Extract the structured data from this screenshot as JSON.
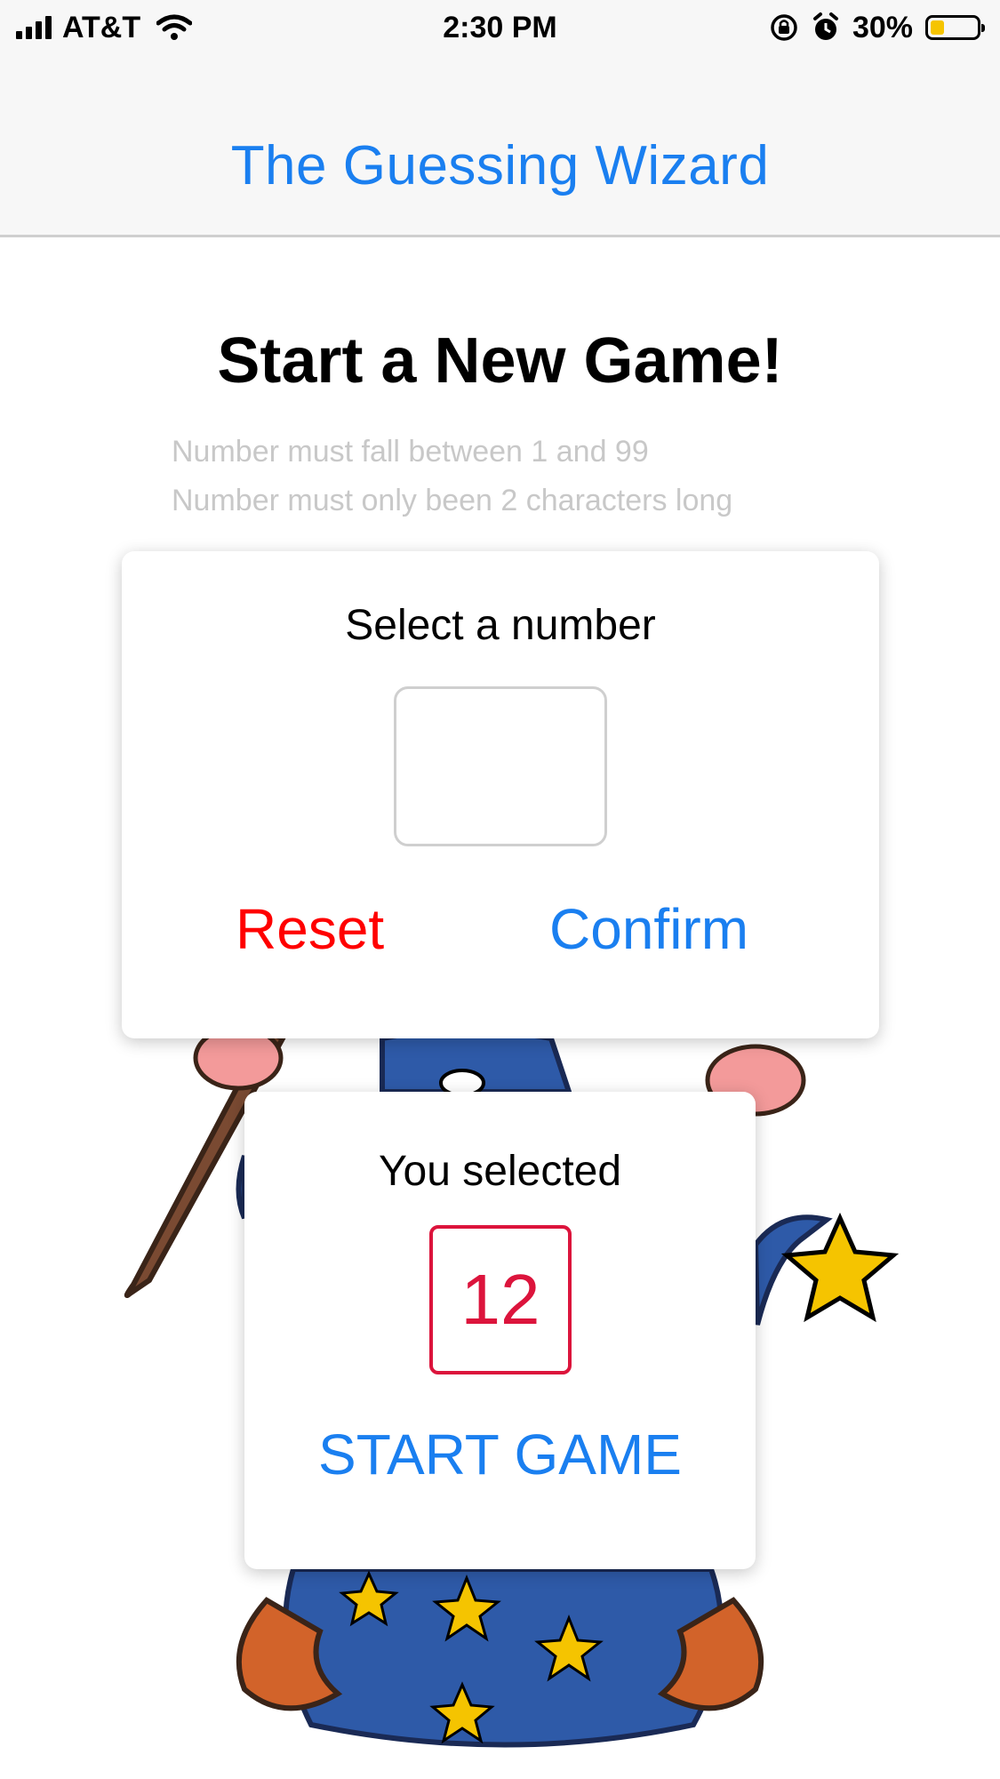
{
  "status_bar": {
    "carrier": "AT&T",
    "time": "2:30 PM",
    "battery": "30%",
    "battery_level": 0.3,
    "icons": [
      "signal-icon",
      "wifi-icon",
      "rotation-lock-icon",
      "alarm-icon",
      "battery-icon"
    ]
  },
  "nav": {
    "title": "The Guessing Wizard"
  },
  "screen": {
    "heading": "Start a New Game!",
    "hints": [
      "Number must fall between 1 and 99",
      "Number must only been 2 characters long"
    ]
  },
  "select_card": {
    "label": "Select a number",
    "input_value": "",
    "reset_label": "Reset",
    "confirm_label": "Confirm"
  },
  "selected_card": {
    "label": "You selected",
    "number": "12",
    "start_label": "START GAME"
  },
  "colors": {
    "primary": "#1a7ff0",
    "danger": "#ff0000",
    "selected": "#dc143c",
    "hint": "#c8c8c8",
    "battery_fill": "#f5c400"
  },
  "illustration": "wizard-image"
}
